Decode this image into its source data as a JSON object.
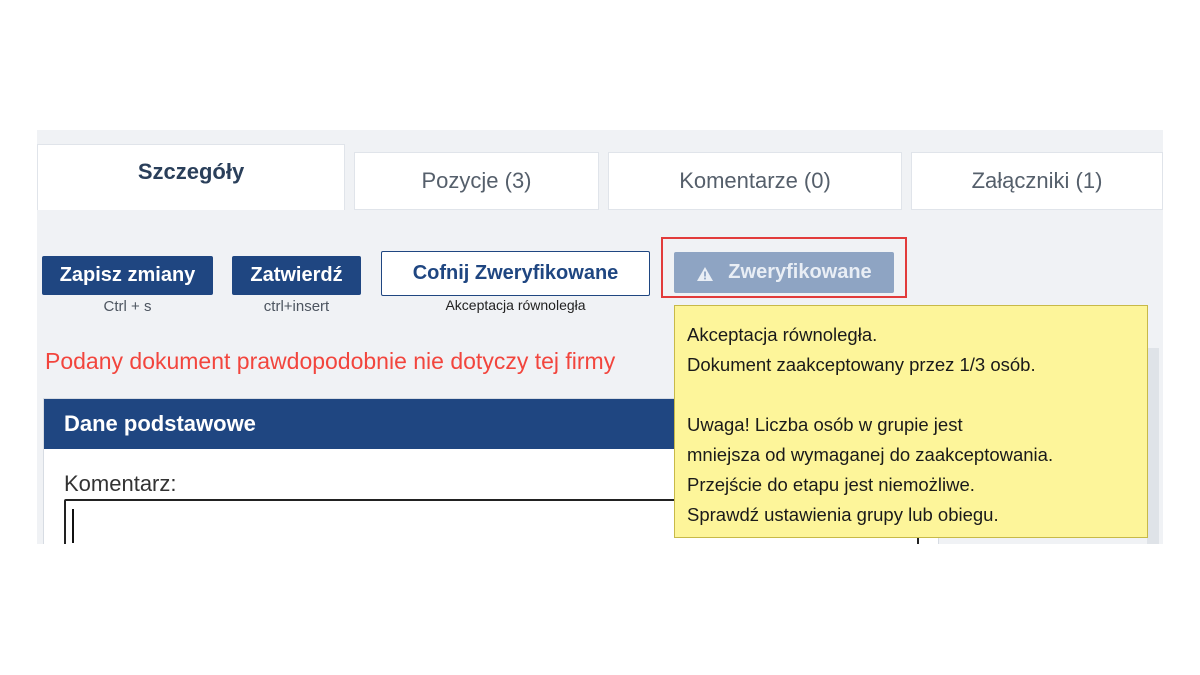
{
  "tabs": [
    {
      "label": "Szczegóły",
      "active": true
    },
    {
      "label": "Pozycje (3)",
      "active": false
    },
    {
      "label": "Komentarze (0)",
      "active": false
    },
    {
      "label": "Załączniki (1)",
      "active": false
    }
  ],
  "toolbar": {
    "save_label": "Zapisz zmiany",
    "save_hint": "Ctrl + s",
    "approve_label": "Zatwierdź",
    "approve_hint": "ctrl+insert",
    "revert_label": "Cofnij Zweryfikowane",
    "revert_hint": "Akceptacja równoległa",
    "verified_label": "Zweryfikowane",
    "verified_icon": "warning-icon"
  },
  "warning_text": "Podany dokument prawdopodobnie nie dotyczy tej firmy",
  "panel": {
    "title": "Dane podstawowe",
    "comment_label": "Komentarz:",
    "comment_value": ""
  },
  "tooltip": {
    "line1": "Akceptacja równoległa.",
    "line2": "Dokument zaakceptowany przez 1/3 osób.",
    "line3": "Uwaga! Liczba osób w grupie jest",
    "line4": "mniejsza od wymaganej do zaakceptowania.",
    "line5": "Przejście do etapu jest niemożliwe.",
    "line6": "Sprawdź ustawienia grupy lub obiegu."
  },
  "colors": {
    "primary": "#1f4681",
    "disabled": "#8ea4c3",
    "warning_text": "#f2453d",
    "highlight": "#e23b3b",
    "tooltip_bg": "#fdf59a"
  }
}
